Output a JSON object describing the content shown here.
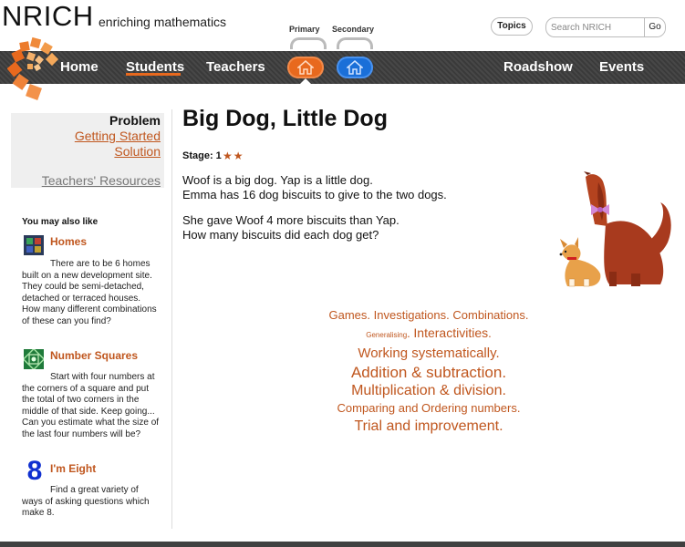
{
  "header": {
    "logo": "NRICH",
    "tagline": "enriching mathematics",
    "primary_label": "Primary",
    "secondary_label": "Secondary",
    "topics_label": "Topics",
    "search_placeholder": "Search NRICH",
    "go_label": "Go"
  },
  "nav": {
    "home": "Home",
    "students": "Students",
    "teachers": "Teachers",
    "roadshow": "Roadshow",
    "events": "Events",
    "accent": "#e8691e",
    "secondary_accent": "#1a6fd8"
  },
  "sidebar": {
    "problem": "Problem",
    "getting_started": "Getting Started",
    "solution": "Solution",
    "teachers_resources": "Teachers' Resources",
    "you_may_also_like": "You may also like",
    "related": [
      {
        "title": "Homes",
        "description": "There are to be 6 homes built on a new development site. They could be semi-detached, detached or terraced houses. How many different combinations of these can you find?"
      },
      {
        "title": "Number Squares",
        "description": "Start with four numbers at the corners of a square and put the total of two corners in the middle of that side. Keep going... Can you estimate what the size of the last four numbers will be?"
      },
      {
        "title": "I'm Eight",
        "description": "Find a great variety of ways of asking questions which make 8.",
        "icon_glyph": "8"
      }
    ]
  },
  "main": {
    "title": "Big Dog, Little Dog",
    "stage_label": "Stage: 1",
    "stars": "★★",
    "para1_line1": "Woof is a big dog. Yap is a little dog.",
    "para1_line2": "Emma has 16 dog biscuits to give to the two dogs.",
    "para2_line1": "She gave Woof 4 more biscuits than Yap.",
    "para2_line2": "How many biscuits did each dog get?"
  },
  "tags": {
    "games": "Games",
    "investigations": "Investigations",
    "combinations": "Combinations",
    "generalising": "Generalising",
    "interactivities": "Interactivities",
    "working_systematically": "Working systematically",
    "addition_subtraction": "Addition & subtraction",
    "multiplication_division": "Multiplication & division",
    "comparing_ordering": "Comparing and Ordering numbers",
    "trial_improvement": "Trial and improvement"
  }
}
